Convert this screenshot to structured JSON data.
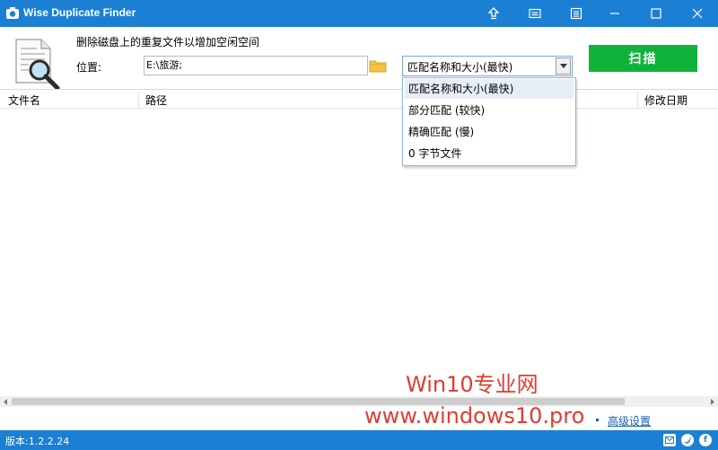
{
  "titlebar": {
    "title": "Wise Duplicate Finder",
    "bg_color": "#1b7fd3",
    "icons": [
      "upload-icon",
      "feedback-icon",
      "menu-icon",
      "minimize-icon",
      "maximize-icon",
      "close-icon"
    ]
  },
  "header": {
    "subtitle": "删除磁盘上的重复文件以增加空闲空间",
    "location_label": "位置:",
    "location_value": "E:\\旅游;",
    "match_mode_selected": "匹配名称和大小(最快)",
    "scan_label": "扫描",
    "scan_color": "#10b33a"
  },
  "table": {
    "columns": [
      "文件名",
      "路径",
      "修改日期"
    ]
  },
  "dropdown": {
    "options": [
      "匹配名称和大小(最快)",
      "部分匹配 (较快)",
      "精确匹配 (慢)",
      "0 字节文件"
    ],
    "selected_index": 0
  },
  "footer": {
    "advanced_label": "高级设置",
    "version": "版本:1.2.2.24",
    "social_icons": [
      "mail-icon",
      "twitter-icon",
      "facebook-icon"
    ]
  },
  "watermark": {
    "line1": "Win10专业网",
    "line2": "www.windows10.pro",
    "color": "#e23b31"
  }
}
